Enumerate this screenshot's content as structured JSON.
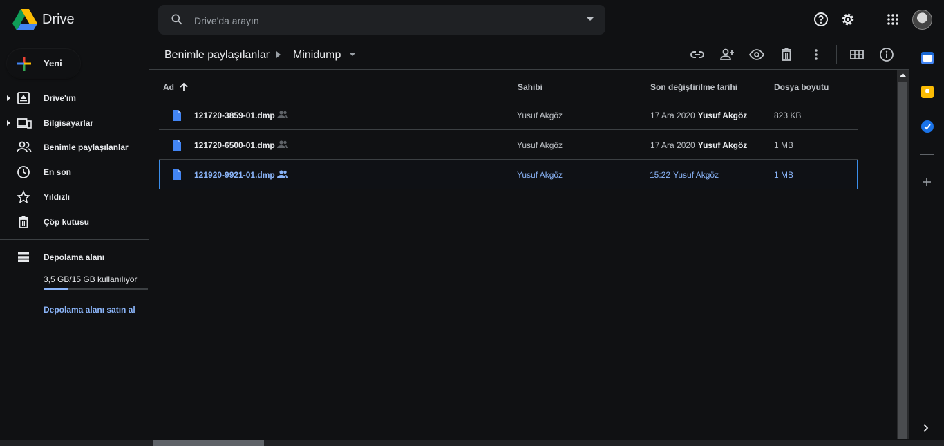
{
  "app": {
    "name": "Drive"
  },
  "search": {
    "placeholder": "Drive'da arayın"
  },
  "new_button": {
    "label": "Yeni"
  },
  "sidebar": {
    "items": [
      {
        "label": "Drive'ım",
        "icon": "my-drive-icon"
      },
      {
        "label": "Bilgisayarlar",
        "icon": "computers-icon"
      },
      {
        "label": "Benimle paylaşılanlar",
        "icon": "shared-icon"
      },
      {
        "label": "En son",
        "icon": "clock-icon"
      },
      {
        "label": "Yıldızlı",
        "icon": "star-icon"
      },
      {
        "label": "Çöp kutusu",
        "icon": "trash-icon"
      }
    ],
    "storage": {
      "label": "Depolama alanı",
      "usage_text": "3,5 GB/15 GB kullanılıyor",
      "used_fraction": 0.23,
      "buy_label": "Depolama alanı satın al"
    }
  },
  "breadcrumb": {
    "parent": "Benimle paylaşılanlar",
    "current": "Minidump"
  },
  "columns": {
    "name": "Ad",
    "owner": "Sahibi",
    "modified": "Son değiştirilme tarihi",
    "size": "Dosya boyutu"
  },
  "files": [
    {
      "name": "121720-3859-01.dmp",
      "owner": "Yusuf Akgöz",
      "modified_date": "17 Ara 2020",
      "modified_by": "Yusuf Akgöz",
      "size": "823 KB",
      "selected": false
    },
    {
      "name": "121720-6500-01.dmp",
      "owner": "Yusuf Akgöz",
      "modified_date": "17 Ara 2020",
      "modified_by": "Yusuf Akgöz",
      "size": "1 MB",
      "selected": false
    },
    {
      "name": "121920-9921-01.dmp",
      "owner": "Yusuf Akgöz",
      "modified_date": "15:22",
      "modified_by": "Yusuf Akgöz",
      "size": "1 MB",
      "selected": true
    }
  ],
  "colors": {
    "accent": "#8ab4f8",
    "selection_border": "#3b8eea",
    "background": "#101113"
  }
}
